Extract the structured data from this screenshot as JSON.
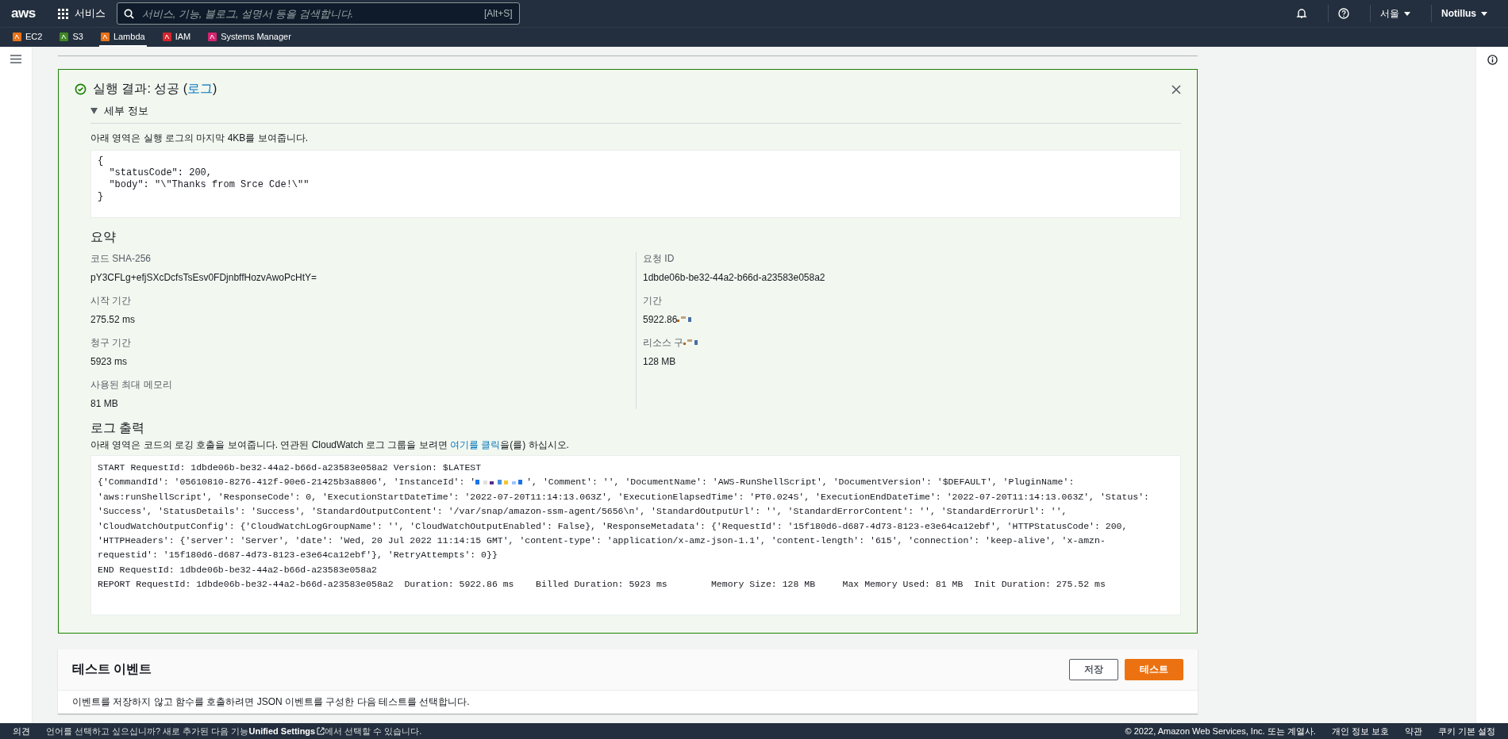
{
  "top_bar": {
    "logo": "aws",
    "services": "서비스",
    "search": {
      "placeholder": "서비스, 기능, 블로그, 설명서 등을 검색합니다.",
      "shortcut": "[Alt+S]"
    },
    "region": "서울",
    "account": "Notillus"
  },
  "favorites": [
    {
      "label": "EC2",
      "color": "#e8731a",
      "selected": false
    },
    {
      "label": "S3",
      "color": "#3f8624",
      "selected": false
    },
    {
      "label": "Lambda",
      "color": "#e8731a",
      "selected": true
    },
    {
      "label": "IAM",
      "color": "#d6242d",
      "selected": false
    },
    {
      "label": "Systems Manager",
      "color": "#d6246e",
      "selected": false
    }
  ],
  "result": {
    "title": "실행 결과: 성공 (",
    "link": "로그",
    "title_end": ")",
    "details": {
      "label": "세부 정보",
      "expanded": true
    },
    "note": "아래 영역은 실행 로그의 마지막 4KB를 보여줍니다.",
    "output": [
      "{",
      "  \"statusCode\": 200,",
      "  \"body\": \"\\\"Thanks from Srce Cde!\\\"\"",
      "}"
    ],
    "summary_title": "요약",
    "summary_left": [
      {
        "kind": "plain",
        "label": "코드 SHA-256",
        "value": "pY3CFLg+efjSXcDcfsTsEsv0FDjnbffHozvAwoPcHtY="
      },
      {
        "kind": "plain",
        "label": "시작 기간",
        "value": "275.52 ms"
      },
      {
        "kind": "plain",
        "label": "청구 기간",
        "value": "5923 ms"
      },
      {
        "kind": "plain",
        "label": "사용된 최대 메모리",
        "value": "81 MB"
      }
    ],
    "summary_right": [
      {
        "kind": "plain",
        "label": "요청 ID",
        "value": "1dbde06b-be32-44a2-b66d-a23583e058a2"
      },
      {
        "kind": "redacted_value",
        "label": "기간",
        "value": "5922.86"
      },
      {
        "kind": "redacted_label",
        "label": "리소스 구",
        "value": "128 MB"
      }
    ],
    "log_title": "로그 출력",
    "log_note": "아래 영역은 코드의 로깅 호출을 보여줍니다. 연관된 CloudWatch 로그 그룹을 보려면 ",
    "log_link": "여기를 클릭",
    "log_note_end": "을(를) 하십시오.",
    "log": [
      [
        {
          "kind": "text",
          "text": "START RequestId: 1dbde06b-be32-44a2-b66d-a23583e058a2 Version: $LATEST"
        }
      ],
      [
        {
          "kind": "text",
          "text": "{'CommandId': '05610810-8276-412f-90e6-21425b3a8806', 'InstanceId': '"
        },
        {
          "kind": "redaction"
        },
        {
          "kind": "text",
          "text": "', 'Comment': '', 'DocumentName': 'AWS-RunShellScript', 'DocumentVersion': '$DEFAULT', 'PluginName':"
        }
      ],
      [
        {
          "kind": "text",
          "text": "'aws:runShellScript', 'ResponseCode': 0, 'ExecutionStartDateTime': '2022-07-20T11:14:13.063Z', 'ExecutionElapsedTime': 'PT0.024S', 'ExecutionEndDateTime': '2022-07-20T11:14:13.063Z', 'Status':"
        }
      ],
      [
        {
          "kind": "text",
          "text": "'Success', 'StatusDetails': 'Success', 'StandardOutputContent': '/var/snap/amazon-ssm-agent/5656\\n', 'StandardOutputUrl': '', 'StandardErrorContent': '', 'StandardErrorUrl': '',"
        }
      ],
      [
        {
          "kind": "text",
          "text": "'CloudWatchOutputConfig': {'CloudWatchLogGroupName': '', 'CloudWatchOutputEnabled': False}, 'ResponseMetadata': {'RequestId': '15f180d6-d687-4d73-8123-e3e64ca12ebf', 'HTTPStatusCode': 200,"
        }
      ],
      [
        {
          "kind": "text",
          "text": "'HTTPHeaders': {'server': 'Server', 'date': 'Wed, 20 Jul 2022 11:14:15 GMT', 'content-type': 'application/x-amz-json-1.1', 'content-length': '615', 'connection': 'keep-alive', 'x-amzn-"
        }
      ],
      [
        {
          "kind": "text",
          "text": "requestid': '15f180d6-d687-4d73-8123-e3e64ca12ebf'}, 'RetryAttempts': 0}}"
        }
      ],
      [
        {
          "kind": "text",
          "text": "END RequestId: 1dbde06b-be32-44a2-b66d-a23583e058a2"
        }
      ],
      [
        {
          "kind": "text",
          "text": "REPORT RequestId: 1dbde06b-be32-44a2-b66d-a23583e058a2  Duration: 5922.86 ms    Billed Duration: 5923 ms        Memory Size: 128 MB     Max Memory Used: 81 MB  Init Duration: 275.52 ms"
        }
      ]
    ]
  },
  "test_event": {
    "title": "테스트 이벤트",
    "save": "저장",
    "test": "테스트",
    "note": "이벤트를 저장하지 않고 함수를 호출하려면 JSON 이벤트를 구성한 다음 테스트를 선택합니다."
  },
  "footer": {
    "feedback": "의견",
    "language_note": "언어를 선택하고 싶으십니까? 새로 추가된 다음 기능",
    "unified": "Unified Settings",
    "language_note_end": "에서 선택할 수 있습니다.",
    "copyright": "© 2022, Amazon Web Services, Inc. 또는 계열사.",
    "links": [
      "개인 정보 보호",
      "약관",
      "쿠키 기본 설정"
    ]
  }
}
